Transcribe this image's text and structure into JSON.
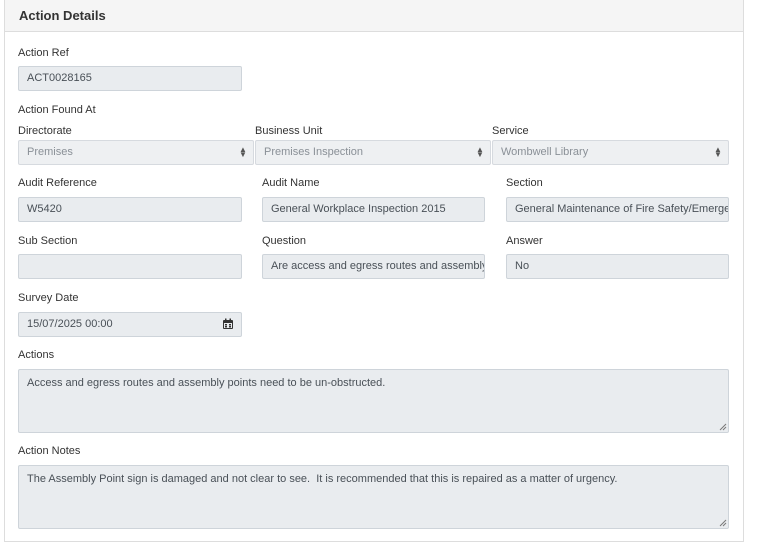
{
  "panel": {
    "title": "Action Details"
  },
  "action_ref": {
    "label": "Action Ref",
    "value": "ACT0028165"
  },
  "action_found_at": {
    "label": "Action Found At"
  },
  "directorate": {
    "label": "Directorate",
    "value": "Premises"
  },
  "business_unit": {
    "label": "Business Unit",
    "value": "Premises Inspection"
  },
  "service": {
    "label": "Service",
    "value": "Wombwell Library"
  },
  "audit_reference": {
    "label": "Audit Reference",
    "value": "W5420"
  },
  "audit_name": {
    "label": "Audit Name",
    "value": "General Workplace Inspection 2015"
  },
  "section": {
    "label": "Section",
    "value": "General Maintenance of Fire Safety/Emergency"
  },
  "sub_section": {
    "label": "Sub Section",
    "value": ""
  },
  "question": {
    "label": "Question",
    "value": "Are access and egress routes and assembly points kept clear?"
  },
  "answer": {
    "label": "Answer",
    "value": "No"
  },
  "survey_date": {
    "label": "Survey Date",
    "value": "15/07/2025 00:00",
    "icon": "calendar-icon"
  },
  "actions": {
    "label": "Actions",
    "value": "Access and egress routes and assembly points need to be un-obstructed."
  },
  "action_notes": {
    "label": "Action Notes",
    "value": "The Assembly Point sign is damaged and not clear to see.  It is recommended that this is repaired as a matter of urgency."
  }
}
